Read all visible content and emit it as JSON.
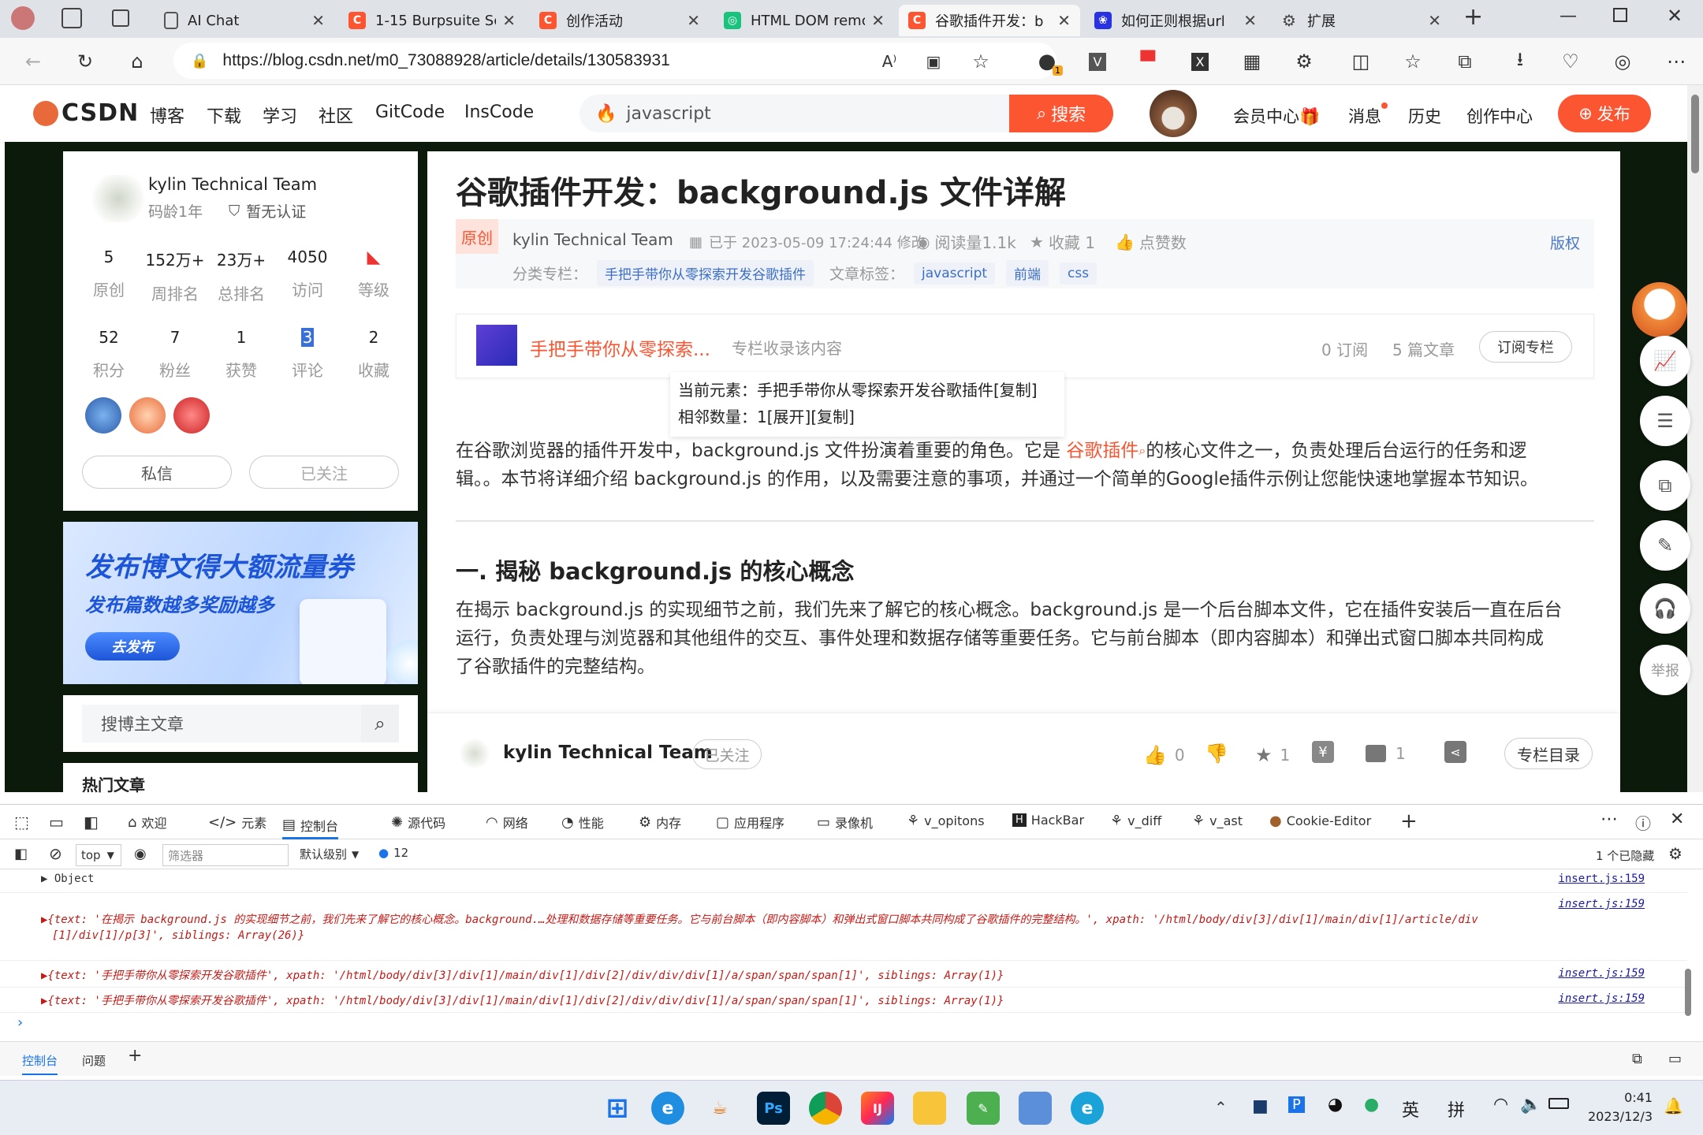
{
  "browser": {
    "tabs": [
      {
        "title": "AI Chat",
        "icon": "page-icon",
        "color": "#ffffff"
      },
      {
        "title": "1-15 Burpsuite Sc",
        "icon": "csdn-icon",
        "color": "#fc5531"
      },
      {
        "title": "创作活动",
        "icon": "csdn-icon",
        "color": "#fc5531"
      },
      {
        "title": "HTML DOM remc",
        "icon": "chatgpt-icon",
        "color": "#19c37d"
      },
      {
        "title": "谷歌插件开发：b",
        "icon": "csdn-icon",
        "color": "#fc5531"
      },
      {
        "title": "如何正则根据url",
        "icon": "baidu-icon",
        "color": "#2932e1"
      },
      {
        "title": "扩展",
        "icon": "puzzle-icon",
        "color": "#555555"
      }
    ],
    "url": "https://blog.csdn.net/m0_73088928/article/details/130583931",
    "ext_badge": "1"
  },
  "csdn": {
    "logo": "CSDN",
    "nav": [
      "博客",
      "下载",
      "学习",
      "社区",
      "GitCode",
      "InsCode"
    ],
    "search_value": "javascript",
    "search_btn": "搜索",
    "right_nav": [
      "会员中心",
      "消息",
      "历史",
      "创作中心"
    ],
    "publish": "发布"
  },
  "profile": {
    "name": "kylin Technical Team",
    "age": "码龄1年",
    "cert": "暂无认证",
    "stats1": [
      {
        "n": "5",
        "l": "原创"
      },
      {
        "n": "152万+",
        "l": "周排名"
      },
      {
        "n": "23万+",
        "l": "总排名"
      },
      {
        "n": "4050",
        "l": "访问"
      },
      {
        "n": "",
        "l": "等级"
      }
    ],
    "stats2": [
      {
        "n": "52",
        "l": "积分"
      },
      {
        "n": "7",
        "l": "粉丝"
      },
      {
        "n": "1",
        "l": "获赞"
      },
      {
        "n": "3",
        "l": "评论"
      },
      {
        "n": "2",
        "l": "收藏"
      }
    ],
    "msg_btn": "私信",
    "follow_btn": "已关注"
  },
  "banner": {
    "title": "发布博文得大额流量券",
    "sub": "发布篇数越多奖励越多",
    "btn": "去发布"
  },
  "blog_search_placeholder": "搜博主文章",
  "hot_title": "热门文章",
  "article": {
    "title": "谷歌插件开发：background.js 文件详解",
    "badge": "原创",
    "author": "kylin Technical Team",
    "date": "已于 2023-05-09 17:24:44 修改",
    "reads": "阅读量1.1k",
    "favs": "收藏 1",
    "likes": "点赞数",
    "copyright": "版权",
    "column_label": "分类专栏：",
    "column": "手把手带你从零探索开发谷歌插件",
    "tags_label": "文章标签：",
    "tags": [
      "javascript",
      "前端",
      "css"
    ],
    "column_card": {
      "name": "手把手带你从零探索...",
      "desc": "专栏收录该内容",
      "subs": "0 订阅",
      "count": "5 篇文章",
      "btn": "订阅专栏"
    },
    "tooltip": [
      "当前元素：手把手带你从零探索开发谷歌插件[复制]",
      "相邻数量：1[展开][复制]"
    ],
    "para1_pre": "在谷歌浏览器的插件开发中，background.js 文件扮演着重要的角色。它是 ",
    "para1_link": "谷歌插件",
    "para1_post": "的核心文件之一，负责处理后台运行的任务和逻",
    "para1_line2": "辑。。本节将详细介绍 background.js 的作用，以及需要注意的事项，并通过一个简单的Google插件示例让您能快速地掌握本节知识。",
    "h2": "一. 揭秘 background.js 的核心概念",
    "para2": [
      "在揭示 background.js 的实现细节之前，我们先来了解它的核心概念。background.js 是一个后台脚本文件，它在插件安装后一直在后台",
      "运行，负责处理与浏览器和其他组件的交互、事件处理和数据存储等重要任务。它与前台脚本（即内容脚本）和弹出式窗口脚本共同构成",
      "了谷歌插件的完整结构。"
    ],
    "bottom": {
      "author": "kylin Technical Team",
      "follow": "已关注",
      "like": "0",
      "fav": "1",
      "comment": "1",
      "toc": "专栏目录"
    }
  },
  "right_tools": [
    "举报"
  ],
  "devtools": {
    "tabs": [
      "欢迎",
      "元素",
      "控制台",
      "源代码",
      "网络",
      "性能",
      "内存",
      "应用程序",
      "录像机",
      "v_opitons",
      "HackBar",
      "v_diff",
      "v_ast",
      "Cookie-Editor"
    ],
    "context": "top",
    "filter_placeholder": "筛选器",
    "level": "默认级别",
    "msg_count": "12",
    "hidden": "1 个已隐藏",
    "logs": [
      {
        "text": "▶ Object",
        "src": "insert.js:159"
      },
      {
        "text": "",
        "src": "insert.js:159"
      },
      {
        "text": "▶{text: '手把手带你从零探索开发谷歌插件', xpath: '/html/body/div[3]/div[1]/main/div[1]/div[2]/div/div/div[1]/a/span/span/span[1]', siblings: Array(1)}",
        "src": "insert.js:159"
      },
      {
        "text": "▶{text: '手把手带你从零探索开发谷歌插件', xpath: '/html/body/div[3]/div[1]/main/div[1]/div[2]/div/div/div[1]/a/span/span/span[1]', siblings: Array(1)}",
        "src": "insert.js:159"
      }
    ],
    "log2_line1": "▶{text: '在揭示 background.js 的实现细节之前，我们先来了解它的核心概念。background.…处理和数据存储等重要任务。它与前台脚本（即内容脚本）和弹出式窗口脚本共同构成了谷歌插件的完整结构。', xpath: '/html/body/div[3]/div[1]/main/div[1]/article/div",
    "log2_line2": "[1]/div[1]/p[3]', siblings: Array(26)}",
    "drawer_tabs": [
      "控制台",
      "问题"
    ]
  },
  "taskbar": {
    "time": "0:41",
    "date": "2023/12/3",
    "ime1": "英",
    "ime2": "拼"
  }
}
